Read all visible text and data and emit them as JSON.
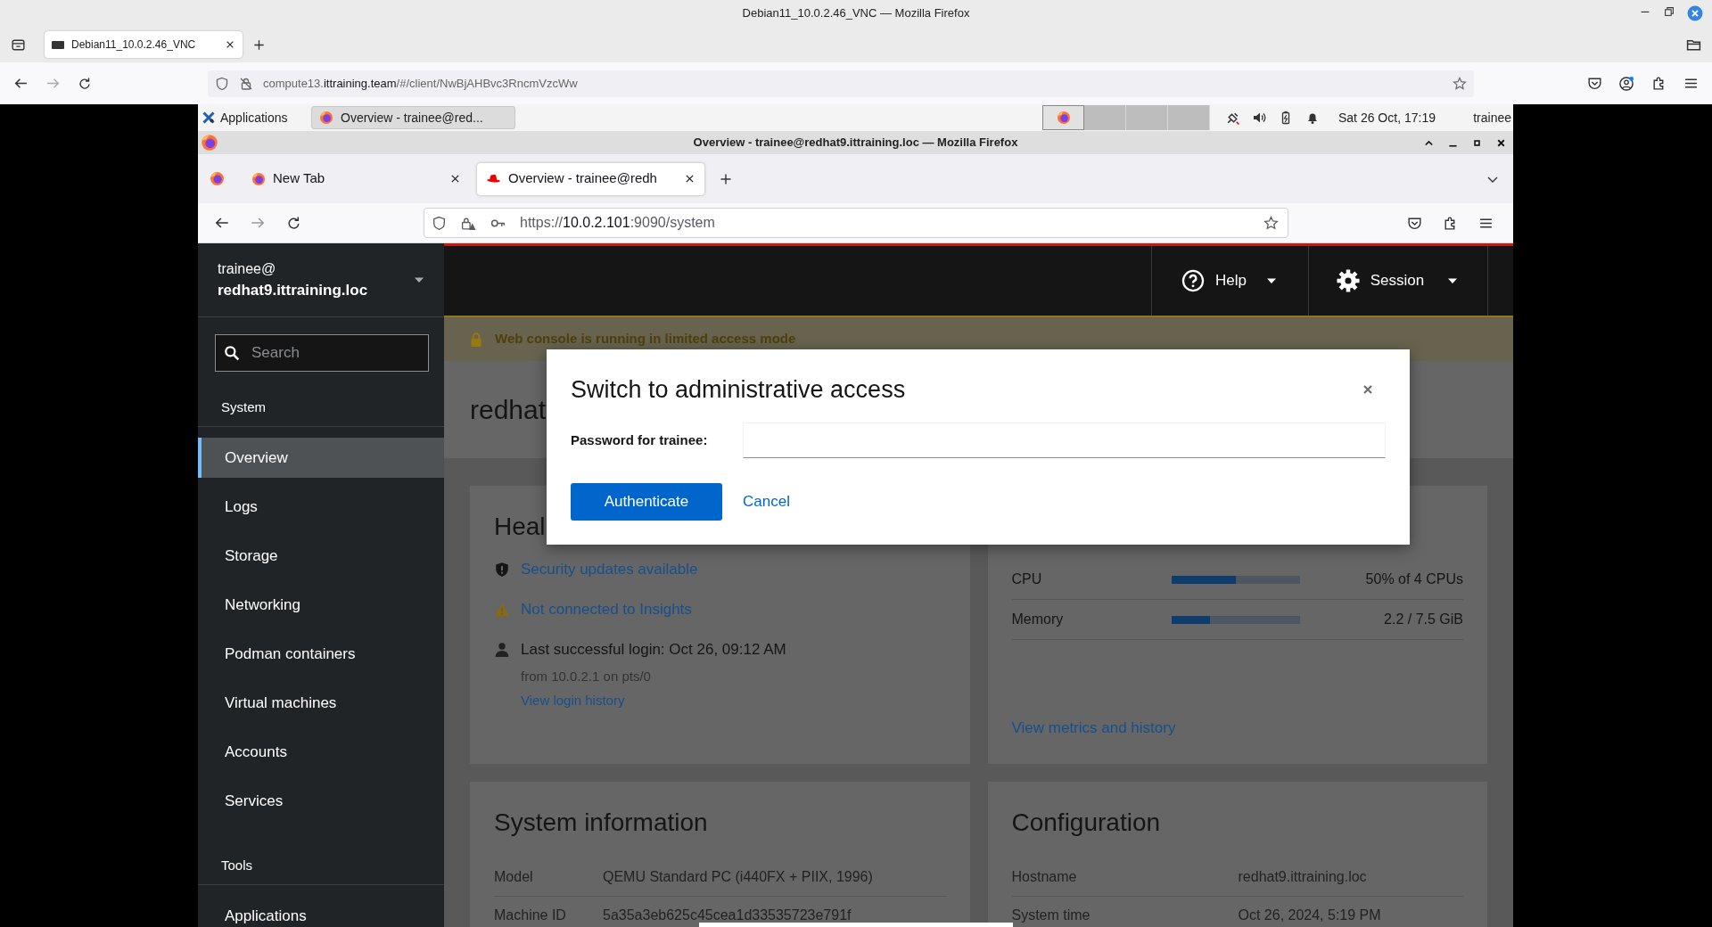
{
  "outer_window": {
    "title": "Debian11_10.0.2.46_VNC — Mozilla Firefox"
  },
  "outer_tabs": [
    {
      "label": "Debian11_10.0.2.46_VNC",
      "selected": true
    }
  ],
  "outer_url": [
    {
      "text": "compute13.",
      "strong": false
    },
    {
      "text": "ittraining.team",
      "strong": true
    },
    {
      "text": "/#/client/NwBjAHBvc3RncmVzcWw",
      "strong": false
    }
  ],
  "desktop_panel": {
    "menu_label": "Applications",
    "tasks": [
      {
        "label": "Overview - trainee@red...",
        "selected": true
      }
    ],
    "workspaces": [
      {
        "selected": true,
        "has_window": true
      },
      {
        "selected": false,
        "has_window": false
      },
      {
        "selected": false,
        "has_window": false
      },
      {
        "selected": false,
        "has_window": false
      }
    ],
    "clock": "Sat 26 Oct, 17:19",
    "user": "trainee"
  },
  "inner_window": {
    "title": "Overview - trainee@redhat9.ittraining.loc — Mozilla Firefox"
  },
  "inner_tabs": [
    {
      "kind": "view",
      "selected": false
    },
    {
      "kind": "newtab",
      "label": "New Tab",
      "selected": false
    },
    {
      "kind": "site",
      "label": "Overview - trainee@redh",
      "selected": true
    }
  ],
  "inner_url": [
    {
      "text": "https://",
      "strong": false
    },
    {
      "text": "10.0.2.101",
      "strong": true
    },
    {
      "text": ":9090/system",
      "strong": false
    }
  ],
  "cockpit": {
    "user": "trainee@",
    "host": "redhat9.ittraining.loc",
    "search": {
      "placeholder": "Search"
    },
    "nav_sections": [
      {
        "heading": "System",
        "items": [
          {
            "label": "Overview",
            "selected": true
          },
          {
            "label": "Logs",
            "selected": false
          },
          {
            "label": "Storage",
            "selected": false
          },
          {
            "label": "Networking",
            "selected": false
          },
          {
            "label": "Podman containers",
            "selected": false
          },
          {
            "label": "Virtual machines",
            "selected": false
          },
          {
            "label": "Accounts",
            "selected": false
          },
          {
            "label": "Services",
            "selected": false
          }
        ]
      },
      {
        "heading": "Tools",
        "items": [
          {
            "label": "Applications",
            "selected": false
          }
        ]
      }
    ],
    "masthead": {
      "help": "Help",
      "session": "Session"
    },
    "banner": "Web console is running in limited access mode",
    "page_title": "redhat",
    "health": {
      "title": "Heal",
      "items": [
        {
          "kind": "security",
          "link": "Security updates available"
        },
        {
          "kind": "insights",
          "link": "Not connected to Insights"
        },
        {
          "kind": "login",
          "text": "Last successful login: Oct 26, 09:12 AM",
          "detail": "from 10.0.2.1 on pts/0",
          "link": "View login history"
        }
      ]
    },
    "usage": {
      "rows": [
        {
          "name": "CPU",
          "level": 0.5,
          "reading": "50% of 4 CPUs"
        },
        {
          "name": "Memory",
          "level": 0.3,
          "reading": "2.2 / 7.5 GiB"
        }
      ],
      "link": "View metrics and history"
    },
    "system_information": {
      "title": "System information",
      "rows": [
        {
          "label": "Model",
          "value": "QEMU Standard PC (i440FX + PIIX, 1996)"
        },
        {
          "label": "Machine ID",
          "value": "5a35a3eb625c45cea1d33535723e791f"
        }
      ]
    },
    "configuration": {
      "title": "Configuration",
      "rows": [
        {
          "label": "Hostname",
          "value": "redhat9.ittraining.loc"
        },
        {
          "label": "System time",
          "value": "Oct 26, 2024, 5:19 PM"
        }
      ]
    }
  },
  "dialog": {
    "title": "Switch to administrative access",
    "password_label": "Password for trainee:",
    "buttons": [
      {
        "kind": "primary",
        "label": "Authenticate"
      },
      {
        "kind": "link",
        "label": "Cancel"
      }
    ]
  }
}
